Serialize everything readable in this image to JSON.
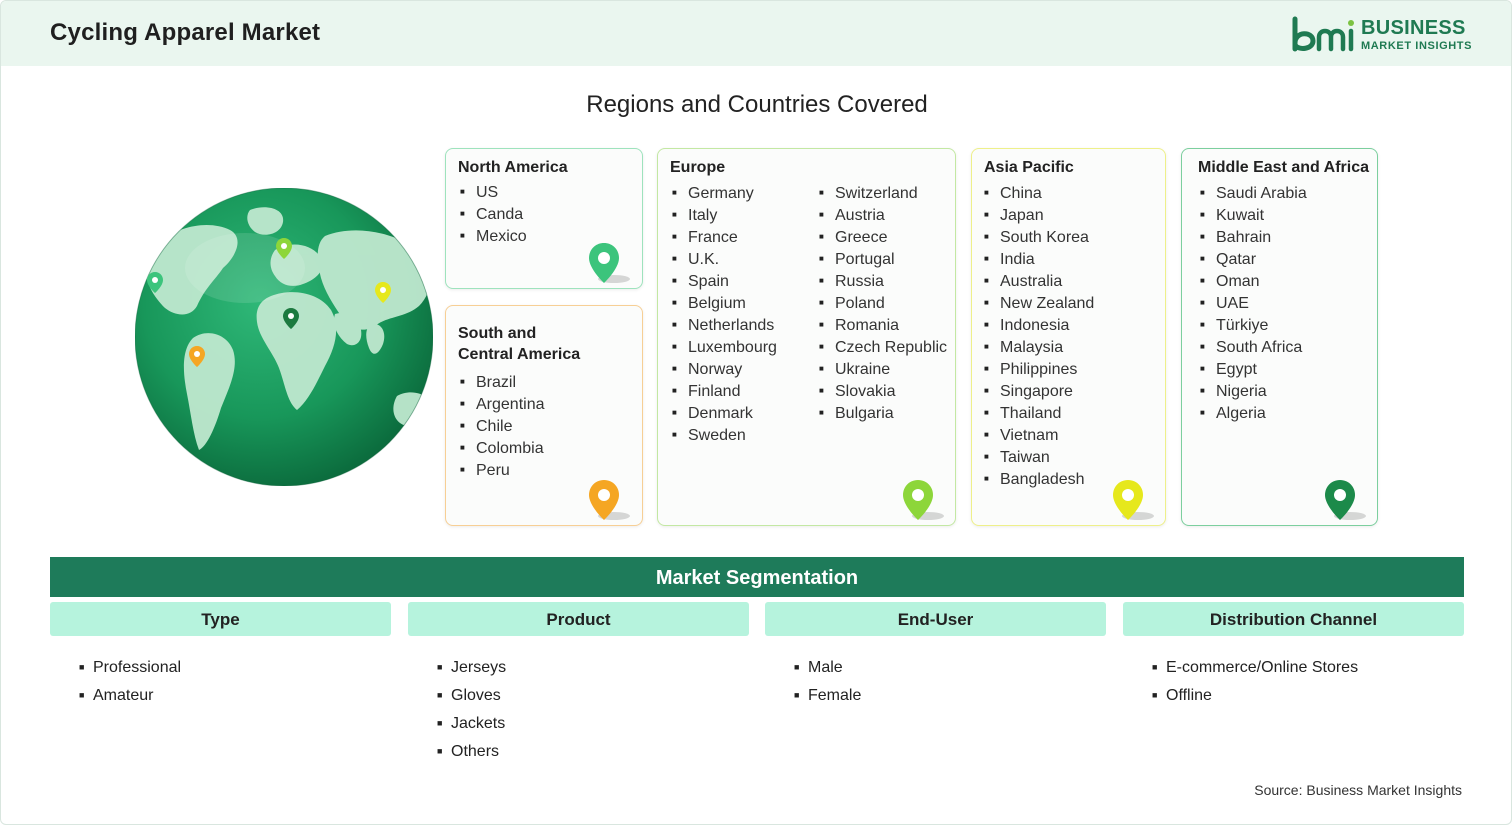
{
  "header": {
    "title": "Cycling Apparel Market"
  },
  "logo": {
    "line1": "BUSINESS",
    "line2": "MARKET INSIGHTS"
  },
  "regions_title": "Regions and Countries Covered",
  "regions": {
    "north_america": {
      "title": "North America",
      "countries": [
        "US",
        "Canda",
        "Mexico"
      ],
      "pin_color": "#3cc47c"
    },
    "south_central_america": {
      "title_line1": "South and",
      "title_line2": "Central America",
      "countries": [
        "Brazil",
        "Argentina",
        "Chile",
        "Colombia",
        "Peru"
      ],
      "pin_color": "#f5a623"
    },
    "europe": {
      "title": "Europe",
      "countries_col1": [
        "Germany",
        "Italy",
        "France",
        "U.K.",
        "Spain",
        "Belgium",
        "Netherlands",
        "Luxembourg",
        "Norway",
        "Finland",
        "Denmark",
        "Sweden"
      ],
      "countries_col2": [
        "Switzerland",
        "Austria",
        "Greece",
        "Portugal",
        "Russia",
        "Poland",
        "Romania",
        "Czech Republic",
        "Ukraine",
        "Slovakia",
        "Bulgaria"
      ],
      "pin_color": "#8dd63a"
    },
    "asia_pacific": {
      "title": "Asia Pacific",
      "countries": [
        "China",
        "Japan",
        "South Korea",
        "India",
        "Australia",
        "New Zealand",
        "Indonesia",
        "Malaysia",
        "Philippines",
        "Singapore",
        "Thailand",
        "Vietnam",
        "Taiwan",
        "Bangladesh"
      ],
      "pin_color": "#e6e81c"
    },
    "middle_east_africa": {
      "title": "Middle East and Africa",
      "countries": [
        "Saudi Arabia",
        "Kuwait",
        "Bahrain",
        "Qatar",
        "Oman",
        "UAE",
        "Türkiye",
        "South Africa",
        "Egypt",
        "Nigeria",
        "Algeria"
      ],
      "pin_color": "#1c8a4a"
    }
  },
  "segmentation": {
    "title": "Market Segmentation",
    "columns": [
      {
        "header": "Type",
        "items": [
          "Professional",
          "Amateur"
        ]
      },
      {
        "header": "Product",
        "items": [
          "Jerseys",
          "Gloves",
          "Jackets",
          "Others"
        ]
      },
      {
        "header": "End-User",
        "items": [
          "Male",
          "Female"
        ]
      },
      {
        "header": "Distribution Channel",
        "items": [
          "E-commerce/Online Stores",
          "Offline"
        ]
      }
    ]
  },
  "source": "Source: Business Market Insights",
  "colors": {
    "brand_green": "#1e7b5a",
    "header_bg": "#eaf6ef",
    "segment_header_bg": "#b6f3dd"
  }
}
